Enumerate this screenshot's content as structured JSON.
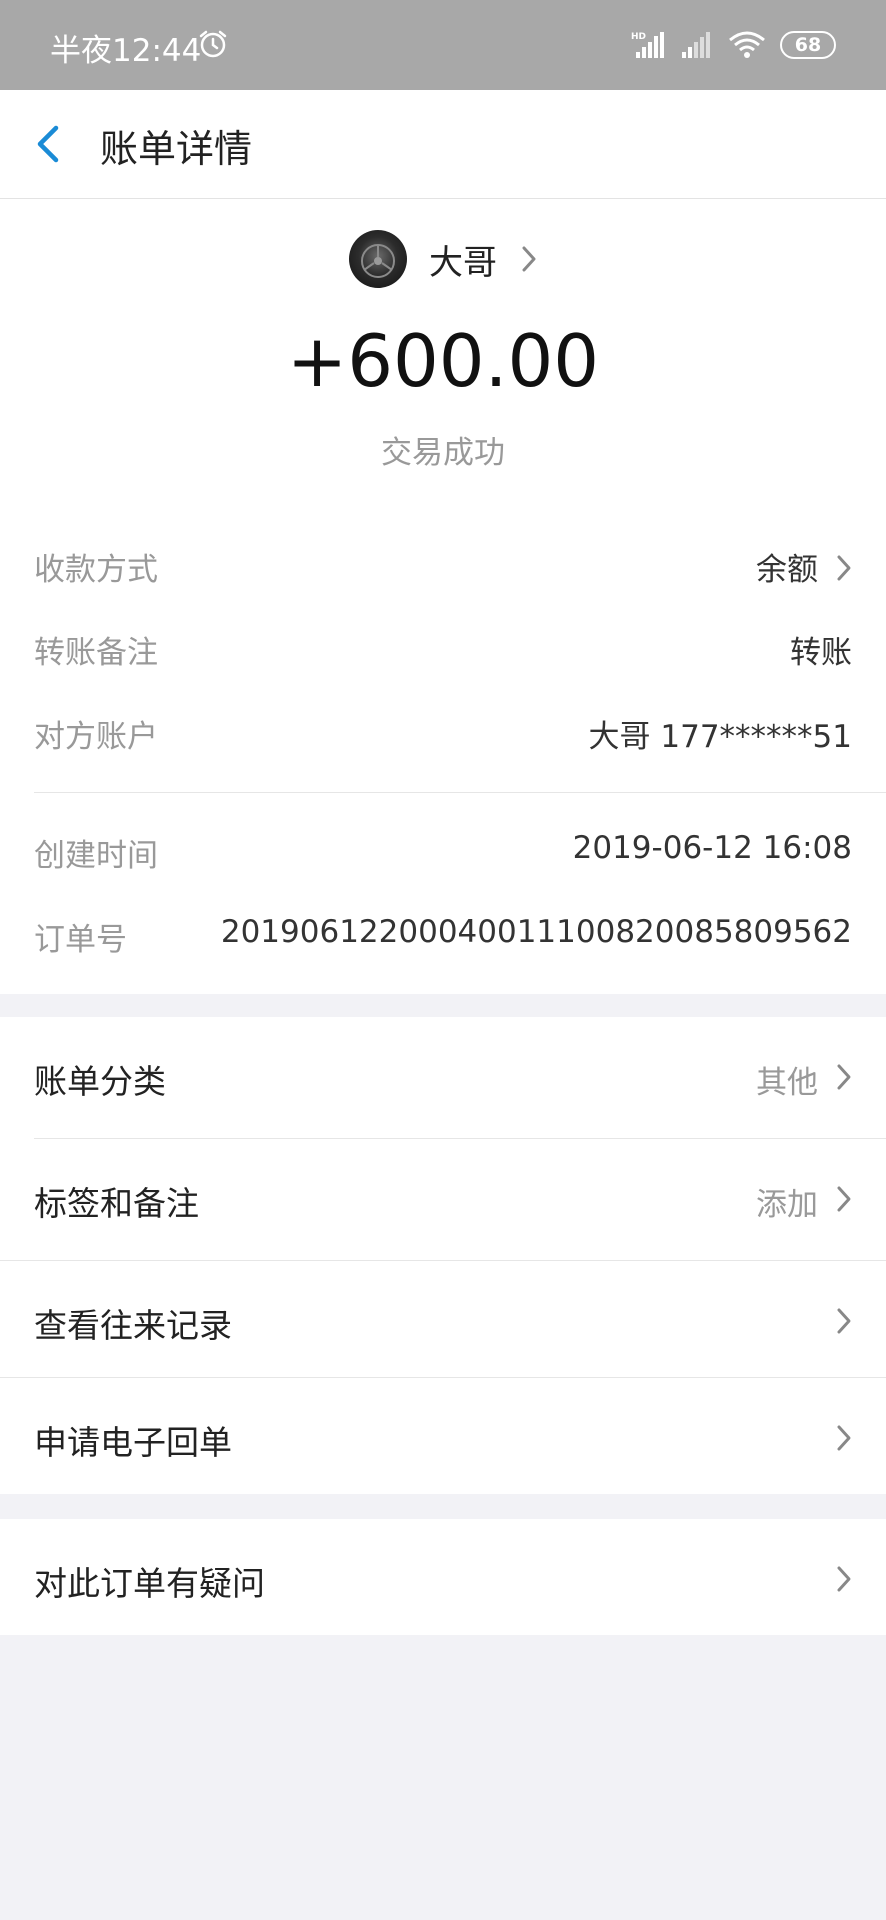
{
  "status_bar": {
    "time": "半夜12:44",
    "battery": "68"
  },
  "nav": {
    "title": "账单详情"
  },
  "summary": {
    "counterpart_name": "大哥",
    "amount": "+600.00",
    "status": "交易成功"
  },
  "details": {
    "payment_method": {
      "label": "收款方式",
      "value": "余额"
    },
    "transfer_note": {
      "label": "转账备注",
      "value": "转账"
    },
    "counterparty_account": {
      "label": "对方账户",
      "value": "大哥 177******51"
    },
    "created_time": {
      "label": "创建时间",
      "value": "2019-06-12 16:08"
    },
    "order_number": {
      "label": "订单号",
      "value": "20190612200040011100820085809562"
    }
  },
  "menu": {
    "category": {
      "label": "账单分类",
      "value": "其他"
    },
    "tags_notes": {
      "label": "标签和备注",
      "value": "添加"
    },
    "history": {
      "label": "查看往来记录"
    },
    "receipt": {
      "label": "申请电子回单"
    },
    "question": {
      "label": "对此订单有疑问"
    }
  },
  "colors": {
    "accent": "#1a8bd6",
    "background": "#f2f2f6",
    "status_bar": "#a8a8a8"
  }
}
